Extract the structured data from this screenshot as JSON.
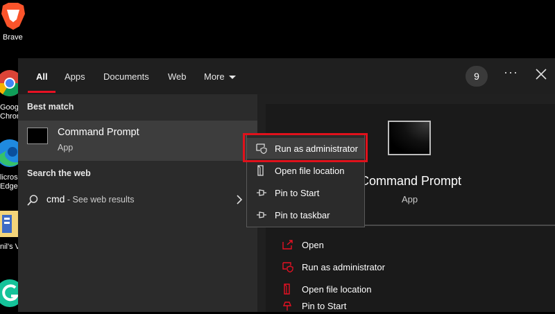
{
  "desktop": {
    "icons": [
      {
        "name": "brave",
        "label": "Brave"
      },
      {
        "name": "chrome",
        "label": "Goog\nChron"
      },
      {
        "name": "edge",
        "label": "licros\nEdge"
      },
      {
        "name": "file",
        "label": "nil's V"
      },
      {
        "name": "grammarly",
        "label": ""
      }
    ]
  },
  "tabs": [
    {
      "label": "All"
    },
    {
      "label": "Apps"
    },
    {
      "label": "Documents"
    },
    {
      "label": "Web"
    },
    {
      "label": "More"
    }
  ],
  "header": {
    "badge": "9",
    "dots": "···"
  },
  "best_match": {
    "heading": "Best match",
    "title": "Command Prompt",
    "subtitle": "App"
  },
  "search_web": {
    "heading": "Search the web",
    "query": "cmd",
    "suffix": " - See web results"
  },
  "context_menu": {
    "items": [
      {
        "label": "Run as administrator",
        "icon": "shield-icon"
      },
      {
        "label": "Open file location",
        "icon": "folder-icon"
      },
      {
        "label": "Pin to Start",
        "icon": "pin-icon"
      },
      {
        "label": "Pin to taskbar",
        "icon": "pin-icon"
      }
    ]
  },
  "detail": {
    "title": "Command Prompt",
    "subtitle": "App",
    "actions": [
      {
        "label": "Open",
        "icon": "open-icon"
      },
      {
        "label": "Run as administrator",
        "icon": "shield-icon"
      },
      {
        "label": "Open file location",
        "icon": "folder-icon"
      },
      {
        "label": "Pin to Start",
        "icon": "pin-icon"
      }
    ]
  },
  "colors": {
    "accent": "#e81123",
    "panel": "#202020",
    "highlight": "#3d3d3d"
  }
}
